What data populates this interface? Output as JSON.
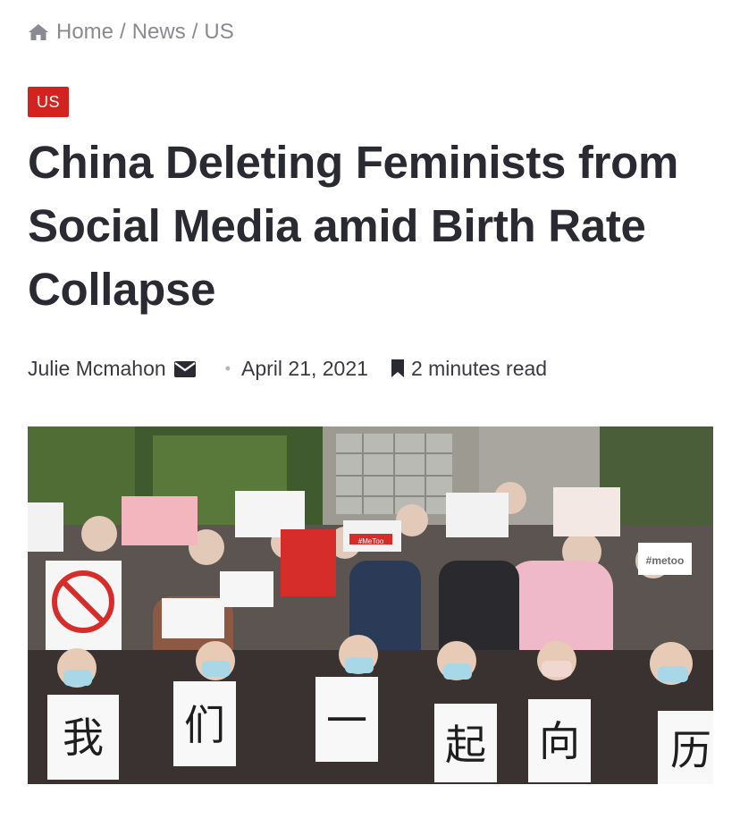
{
  "breadcrumb": {
    "items": [
      "Home",
      "News",
      "US"
    ],
    "separator": "/"
  },
  "category": "US",
  "title": "China Deleting Feminists from Social Media amid Birth Rate Collapse",
  "meta": {
    "author": "Julie Mcmahon",
    "date": "April 21, 2021",
    "read_time": "2 minutes read"
  },
  "image": {
    "sign_chars": [
      "我",
      "们",
      "一",
      "起",
      "向",
      "历"
    ],
    "small_signs": [
      "#metoo",
      "#MeToo"
    ]
  },
  "colors": {
    "accent": "#d3231f",
    "title": "#2a2a32",
    "muted": "#8a8a92"
  },
  "icons": [
    "home-icon",
    "mail-icon",
    "bookmark-icon"
  ]
}
